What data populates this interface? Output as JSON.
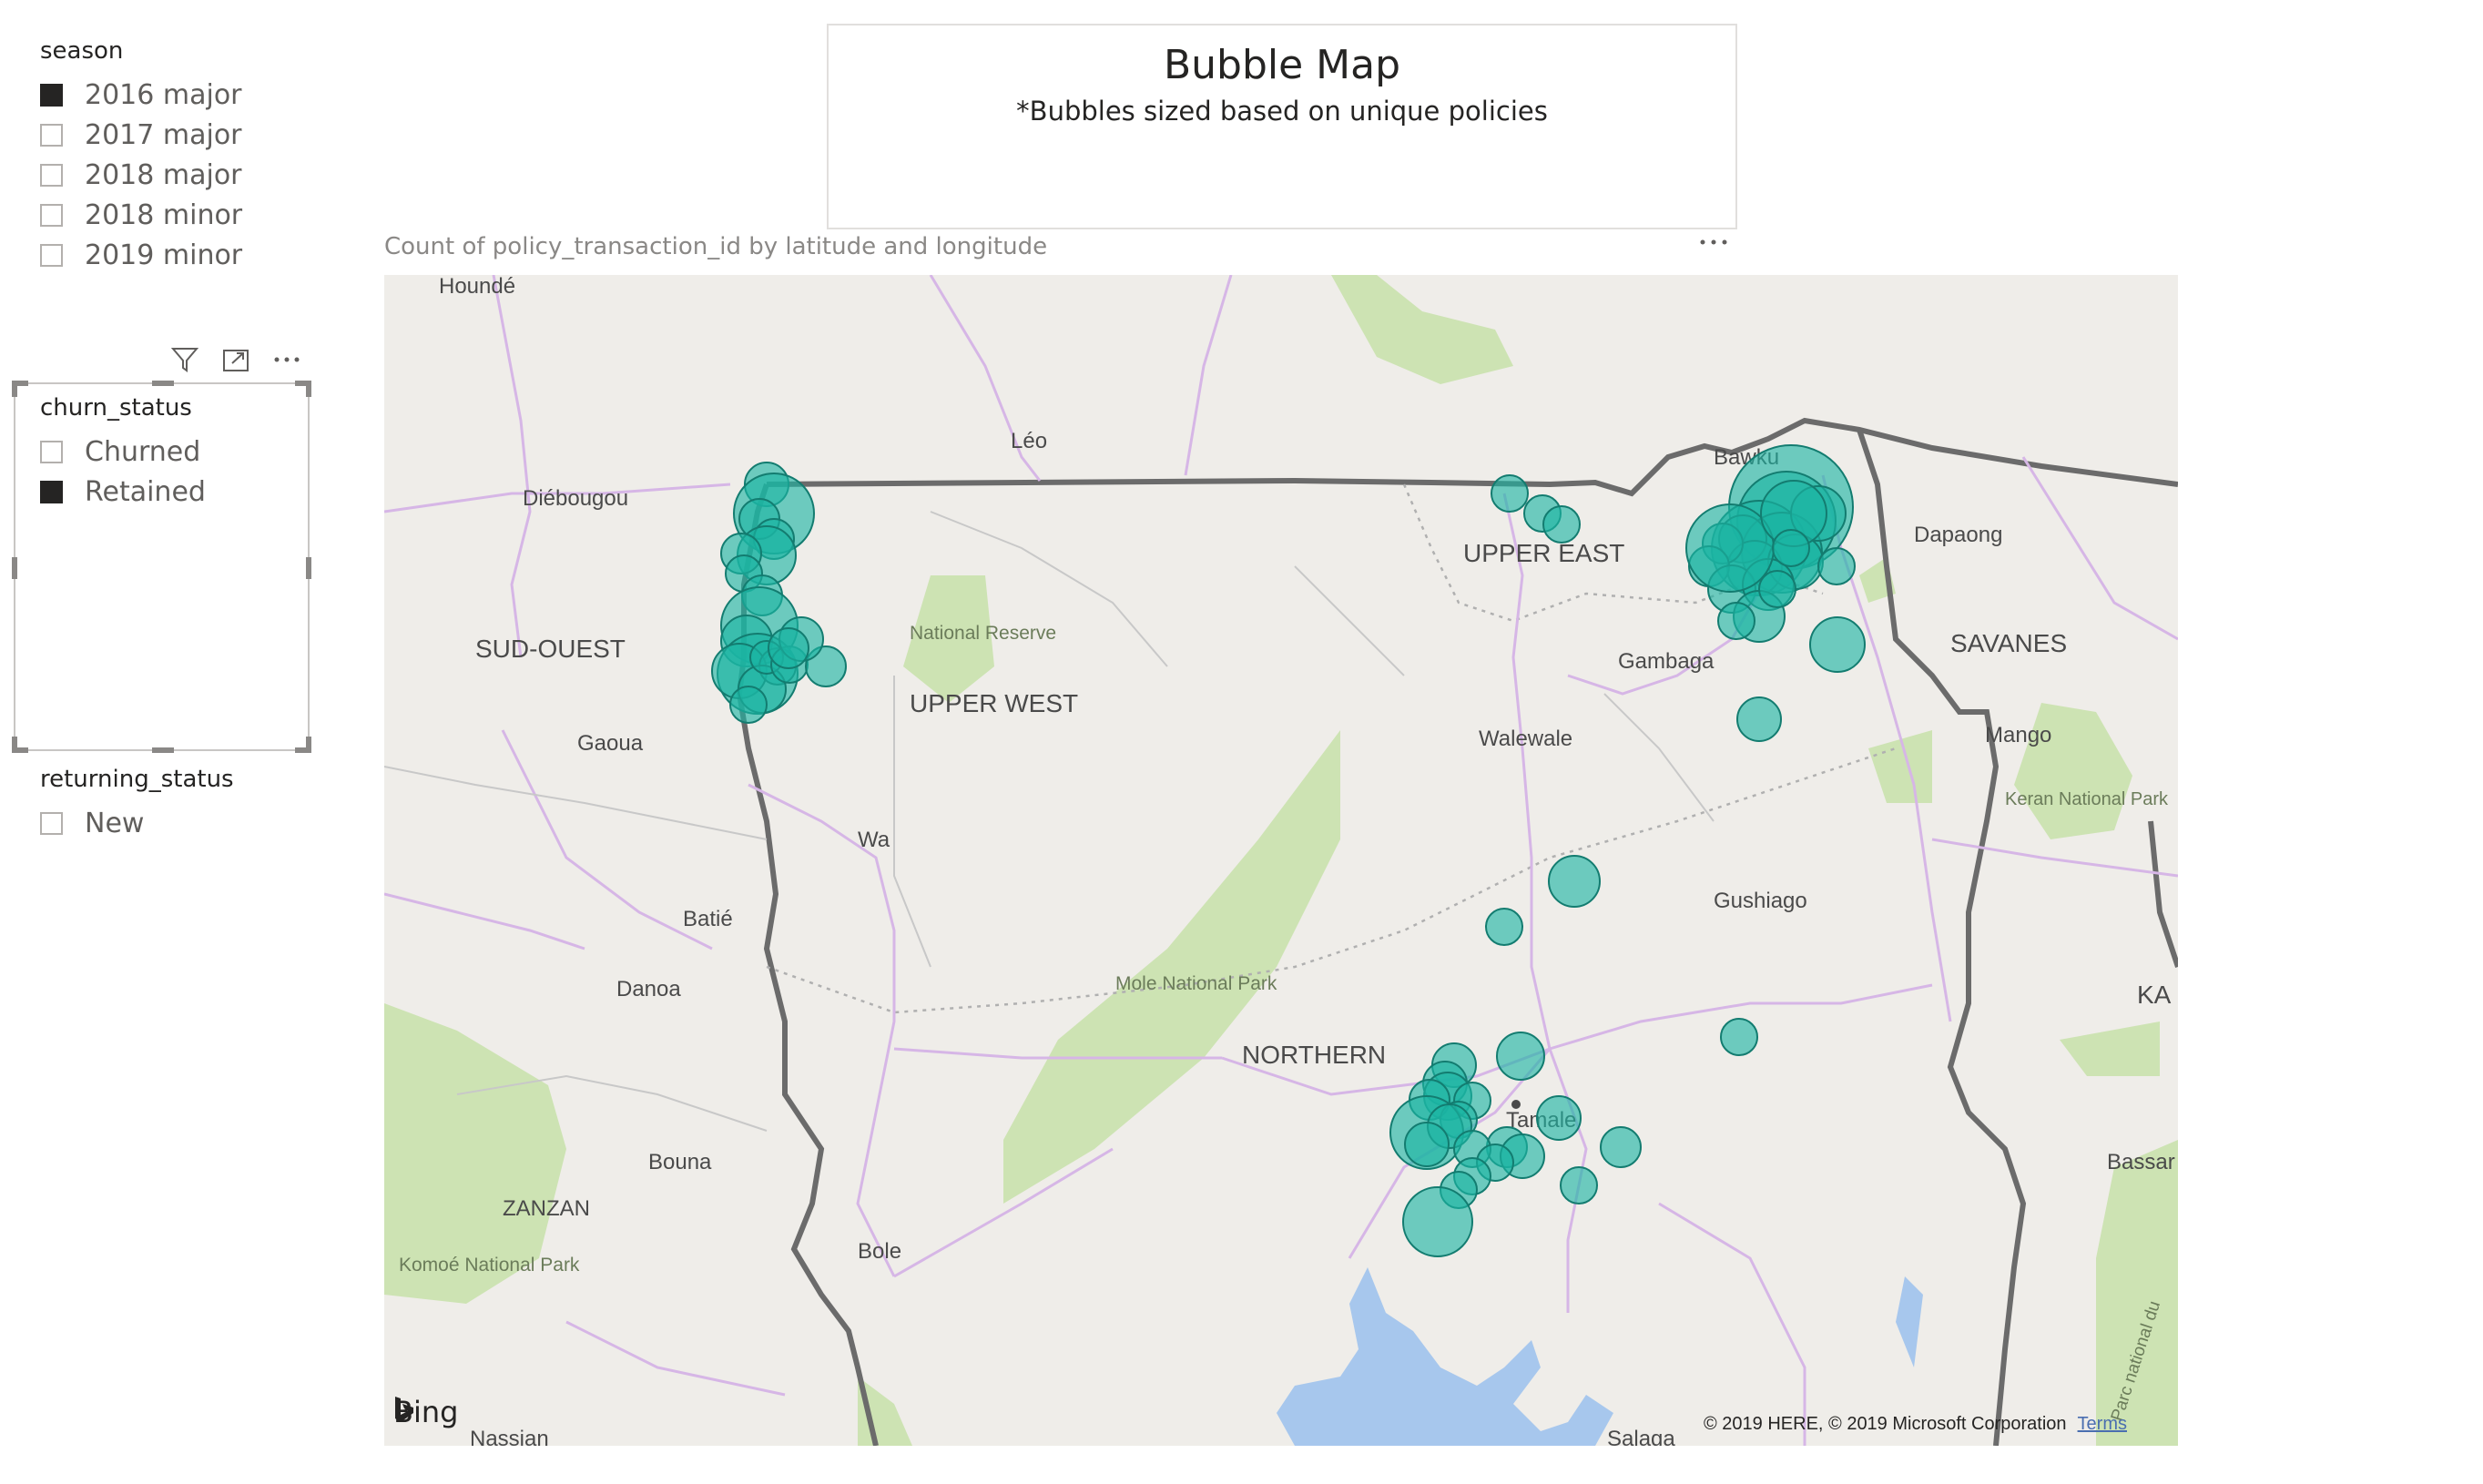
{
  "slicers": {
    "season": {
      "title": "season",
      "items": [
        {
          "label": "2016 major",
          "checked": true
        },
        {
          "label": "2017 major",
          "checked": false
        },
        {
          "label": "2018 major",
          "checked": false
        },
        {
          "label": "2018 minor",
          "checked": false
        },
        {
          "label": "2019 minor",
          "checked": false
        }
      ]
    },
    "churn_status": {
      "title": "churn_status",
      "items": [
        {
          "label": "Churned",
          "checked": false
        },
        {
          "label": "Retained",
          "checked": true
        }
      ]
    },
    "returning_status": {
      "title": "returning_status",
      "items": [
        {
          "label": "New",
          "checked": false
        }
      ]
    }
  },
  "title_card": {
    "title": "Bubble Map",
    "subtitle": "*Bubbles sized based on unique policies"
  },
  "map_visual": {
    "title": "Count of policy_transaction_id by latitude and longitude",
    "more_label": "...",
    "bubble_color": "#1bb5a3",
    "bing_label": "Bing",
    "copyright": "© 2019 HERE, © 2019 Microsoft Corporation",
    "terms_label": "Terms",
    "place_labels": {
      "hounde": "Houndé",
      "leo": "Léo",
      "diebougou": "Diébougou",
      "bawku": "Bawku",
      "dapaong": "Dapaong",
      "upper_east": "UPPER EAST",
      "sud_ouest": "SUD-OUEST",
      "national_reserve": "National Reserve",
      "upper_west": "UPPER WEST",
      "savanes": "SAVANES",
      "gambaga": "Gambaga",
      "gaoua": "Gaoua",
      "walewale": "Walewale",
      "mango": "Mango",
      "keran": "Keran National Park",
      "wa": "Wa",
      "gushiago": "Gushiago",
      "batie": "Batié",
      "mole": "Mole National Park",
      "danoa": "Danoa",
      "ka": "KA",
      "northern": "NORTHERN",
      "tamale": "Tamale",
      "bouna": "Bouna",
      "bassar": "Bassar",
      "zanzan": "ZANZAN",
      "komoe": "Komoé National Park",
      "bole": "Bole",
      "nassian": "Nassian",
      "salaga": "Salaga",
      "parc": "Parc national du"
    }
  }
}
